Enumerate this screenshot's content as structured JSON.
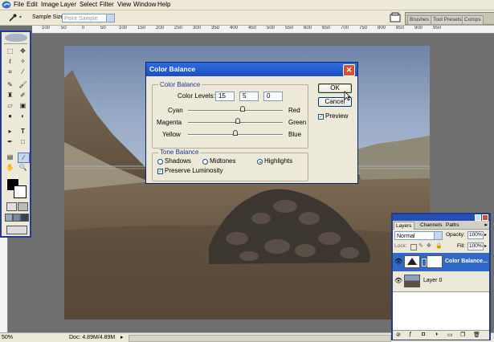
{
  "menu": [
    "File",
    "Edit",
    "Image",
    "Layer",
    "Select",
    "Filter",
    "View",
    "Window",
    "Help"
  ],
  "options_bar": {
    "sample_size_label": "Sample Size:",
    "sample_size_value": "Point Sample",
    "palette_tabs": [
      "Brushes",
      "Tool Presets",
      "Comps"
    ]
  },
  "ruler_top": [
    "100",
    "50",
    "0",
    "50",
    "100",
    "150",
    "200",
    "250",
    "300",
    "350",
    "400",
    "450",
    "500",
    "550",
    "600",
    "650",
    "700",
    "750",
    "800",
    "850",
    "900",
    "950"
  ],
  "toolbox": {
    "tools": [
      "marquee",
      "move",
      "lasso",
      "magic-wand",
      "crop",
      "slice",
      "heal",
      "brush",
      "stamp",
      "history-brush",
      "eraser",
      "gradient",
      "blur",
      "dodge",
      "path-select",
      "type",
      "pen",
      "shape",
      "notes",
      "eyedropper",
      "hand",
      "zoom"
    ]
  },
  "status": {
    "zoom": "50%",
    "doc": "Doc: 4.89M/4.89M"
  },
  "dialog": {
    "title": "Color Balance",
    "group_color": "Color Balance",
    "levels_label": "Color Levels:",
    "levels": [
      "15",
      "5",
      "0"
    ],
    "sliders": [
      {
        "left": "Cyan",
        "right": "Red",
        "value": 15
      },
      {
        "left": "Magenta",
        "right": "Green",
        "value": 5
      },
      {
        "left": "Yellow",
        "right": "Blue",
        "value": 0
      }
    ],
    "group_tone": "Tone Balance",
    "tones": [
      {
        "label": "Shadows",
        "selected": false
      },
      {
        "label": "Midtones",
        "selected": false
      },
      {
        "label": "Highlights",
        "selected": true
      }
    ],
    "preserve_label": "Preserve Luminosity",
    "preserve_checked": true,
    "ok": "OK",
    "cancel": "Cancel",
    "preview_label": "Preview",
    "preview_checked": true
  },
  "layers_panel": {
    "tabs": [
      "Layers",
      "Channels",
      "Paths"
    ],
    "blend_mode": "Normal",
    "opacity_label": "Opacity:",
    "opacity": "100%",
    "lock_label": "Lock:",
    "fill_label": "Fill:",
    "fill": "100%",
    "layers": [
      {
        "name": "Color Balance...",
        "selected": true
      },
      {
        "name": "Layer 0",
        "selected": false
      }
    ]
  },
  "colors": {
    "accent": "#2350b8",
    "dialog_title": "#1a4fc6",
    "close": "#d9502c"
  }
}
